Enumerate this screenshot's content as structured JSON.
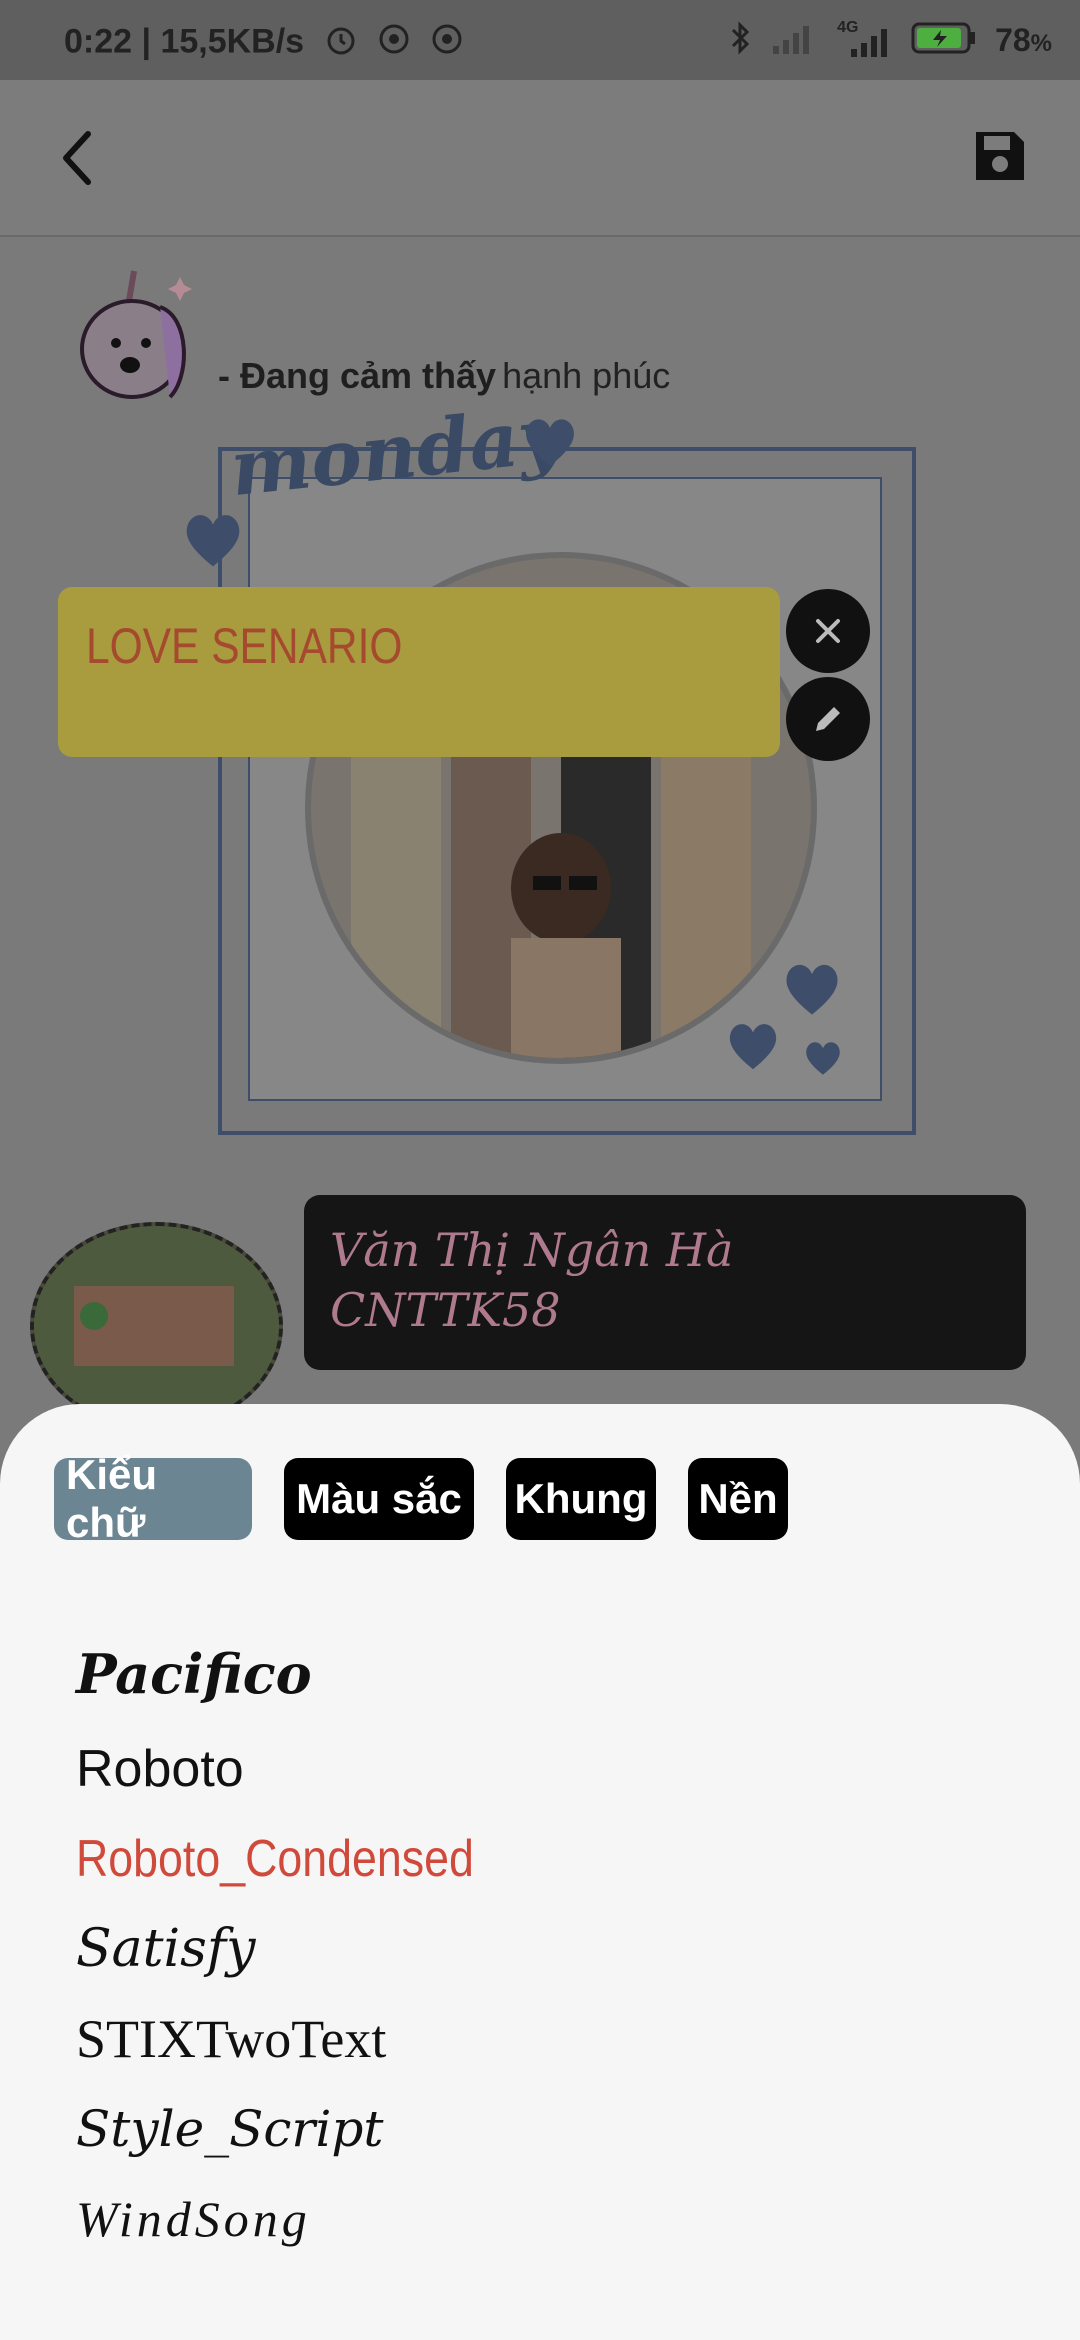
{
  "status_bar": {
    "time_speed": "0:22 | 15,5KB/s",
    "network_label": "4G",
    "battery_percent": "78",
    "battery_unit": "%",
    "icons": [
      "alarm-icon",
      "sync-icon",
      "sync-icon",
      "bluetooth-icon",
      "signal-icon",
      "signal-icon",
      "battery-icon"
    ]
  },
  "app_bar": {
    "back_icon": "chevron-left-icon",
    "save_icon": "floppy-disk-icon"
  },
  "canvas": {
    "mood_prefix": "- Đang cảm thấy",
    "mood_value": "hạnh phúc",
    "sticker_text": "monday",
    "text_box": "LOVE SENARIO",
    "name_lines": [
      "Văn Thị Ngân Hà",
      "CNTTK58"
    ],
    "overlay_buttons": [
      "close-icon",
      "pencil-icon"
    ]
  },
  "sheet": {
    "tabs": [
      {
        "label": "Kiểu chữ",
        "active": true
      },
      {
        "label": "Màu sắc",
        "active": false
      },
      {
        "label": "Khung",
        "active": false
      },
      {
        "label": "Nền",
        "active": false
      }
    ],
    "fonts": [
      {
        "label": "Pacifico",
        "selected": false
      },
      {
        "label": "Roboto",
        "selected": false
      },
      {
        "label": "Roboto_Condensed",
        "selected": true
      },
      {
        "label": "Satisfy",
        "selected": false
      },
      {
        "label": "STIXTwoText",
        "selected": false
      },
      {
        "label": "Style_Script",
        "selected": false
      },
      {
        "label": "WindSong",
        "selected": false
      }
    ]
  },
  "colors": {
    "active_tab": "#6c8593",
    "selected_font": "#d04a3c",
    "text_box_bg": "#a89c3e",
    "text_box_text": "#a54a2f"
  }
}
